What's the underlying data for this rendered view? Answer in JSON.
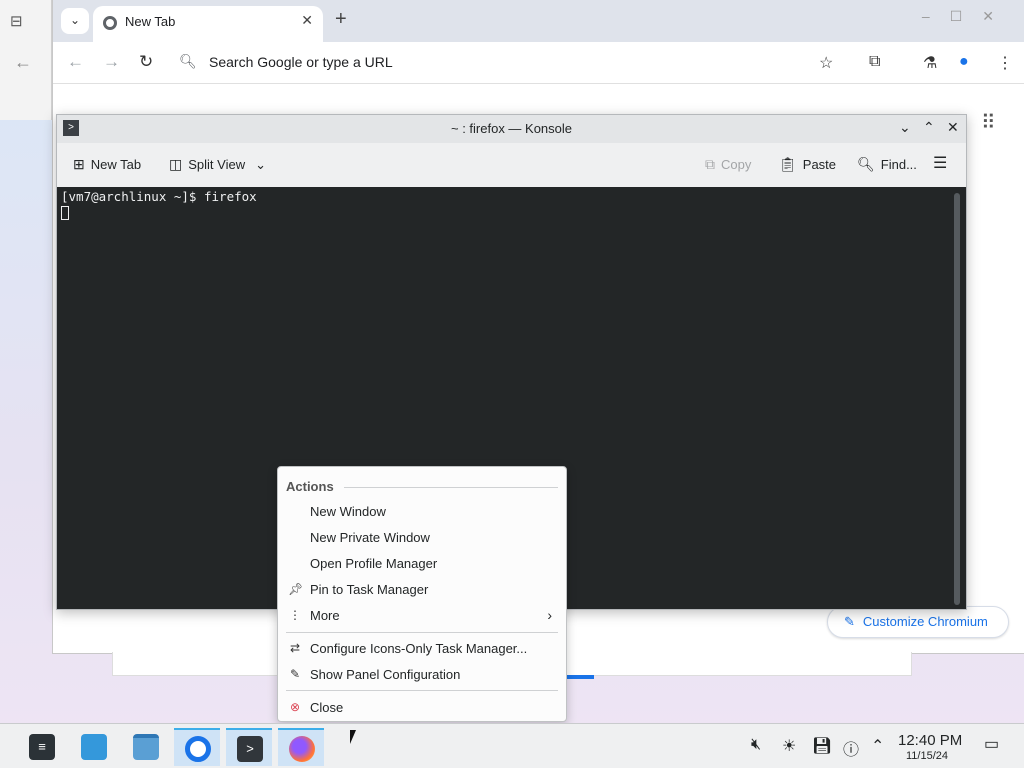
{
  "chromium": {
    "tab_title": "New Tab",
    "omnibox_placeholder": "Search Google or type a URL",
    "customize_label": "Customize Chromium",
    "icons": [
      "chevron-down-icon",
      "chromium-favicon",
      "close-icon",
      "plus-icon",
      "minimize-icon",
      "maximize-icon",
      "close-icon",
      "back-icon",
      "forward-icon",
      "reload-icon",
      "search-icon",
      "star-icon",
      "extensions-icon",
      "labs-icon",
      "profile-icon",
      "menu-icon",
      "apps-grid-icon",
      "pencil-icon"
    ]
  },
  "konsole": {
    "title": "~ : firefox — Konsole",
    "toolbar": {
      "new_tab": "New Tab",
      "split_view": "Split View",
      "copy": "Copy",
      "paste": "Paste",
      "find": "Find..."
    },
    "terminal_line": "[vm7@archlinux ~]$ firefox"
  },
  "context_menu": {
    "header": "Actions",
    "items": [
      "New Window",
      "New Private Window",
      "Open Profile Manager",
      "Pin to Task Manager",
      "More",
      "Configure Icons-Only Task Manager...",
      "Show Panel Configuration",
      "Close"
    ]
  },
  "taskbar": {
    "apps": [
      "application-launcher",
      "discover",
      "dolphin",
      "chromium",
      "konsole",
      "firefox"
    ],
    "clock_time": "12:40 PM",
    "clock_date": "11/15/24"
  },
  "colors": {
    "accent": "#3daee9",
    "chrome_blue": "#1a73e8",
    "terminal_bg": "#232627"
  }
}
